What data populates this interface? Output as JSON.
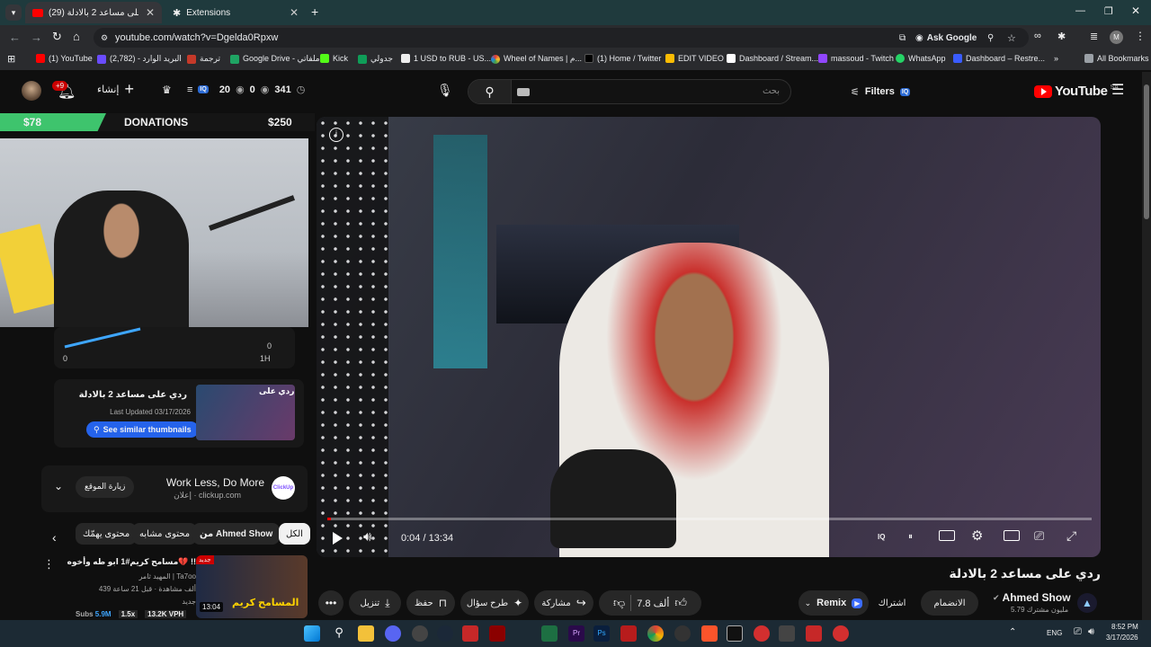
{
  "browser": {
    "tabs": [
      {
        "title": "(29) ردي على مساعد 2 بالادلة",
        "active": true
      },
      {
        "title": "Extensions",
        "active": false
      }
    ],
    "url": "youtube.com/watch?v=Dgelda0Rpxw",
    "ask_google": "Ask Google",
    "bookmarks": [
      "(1) YouTube",
      "(2,782) - البريد الوارد",
      "ترجمة",
      "Google Drive - ملفاتي",
      "Kick",
      "جدولي",
      "1 USD to RUB - US...",
      "Wheel of Names | م...",
      "(1) Home / Twitter",
      "EDIT VIDEO",
      "Dashboard / Stream...",
      "massoud - Twitch",
      "WhatsApp",
      "Dashboard – Restre..."
    ],
    "all_bookmarks": "All Bookmarks"
  },
  "youtube": {
    "logo": "YouTube",
    "logo_region": "SA",
    "search_placeholder": "بحث",
    "filters": "Filters",
    "create_label": "إنشاء",
    "notif_badge": "+9",
    "counters": {
      "a": "20",
      "b": "0",
      "c": "341"
    }
  },
  "left": {
    "donations_left": "$78",
    "donations_title": "DONATIONS",
    "donations_right": "$250",
    "graph_zero": "0",
    "graph_1h": "1H",
    "graph_right0": "0",
    "thumb_title": "ردي على مساعد 2 بالادلة",
    "updated": "Last Updated 03/17/2026",
    "similar": "See similar thumbnails",
    "thumb_overlay": "ردي على",
    "ad_title": "Work Less, Do More",
    "ad_sub": "إعلان · clickup.com",
    "ad_visit": "زيارة الموقع",
    "ad_logo": "ClickUp",
    "chips": [
      "الكل",
      "من Ahmed Show",
      "محتوى مشابه",
      "محتوى يهمّك"
    ],
    "rec_title": "مسامح كريم#1 ابو طه وأخوه💔 !!",
    "rec_channel": "المهيد ثامر | Ta7oo",
    "rec_meta": "439 ألف مشاهدة · قبل 21 ساعة",
    "rec_new": "جديد",
    "rec_duration": "13:04",
    "rec_badge": "جديد",
    "rec_thumb_text": "المسامح كريم",
    "stats": {
      "subs_label": "Subs",
      "subs": "5.9M",
      "mult": "1.5x",
      "vph": "13.2K VPH"
    }
  },
  "player": {
    "time": "0:04 / 13:34",
    "progress": 0.005
  },
  "below": {
    "title": "ردي على مساعد 2 بالادلة",
    "channel": "Ahmed Show",
    "subs": "5.79 مليون مشترك",
    "join": "الانضمام",
    "subscribe": "اشتراك",
    "remix": "Remix",
    "likes": "7.8 ألف",
    "share": "مشاركة",
    "ask": "طرح سؤال",
    "save": "حفظ",
    "download": "تنزيل"
  },
  "taskbar": {
    "lang": "ENG",
    "time": "8:52 PM",
    "date": "3/17/2026"
  }
}
